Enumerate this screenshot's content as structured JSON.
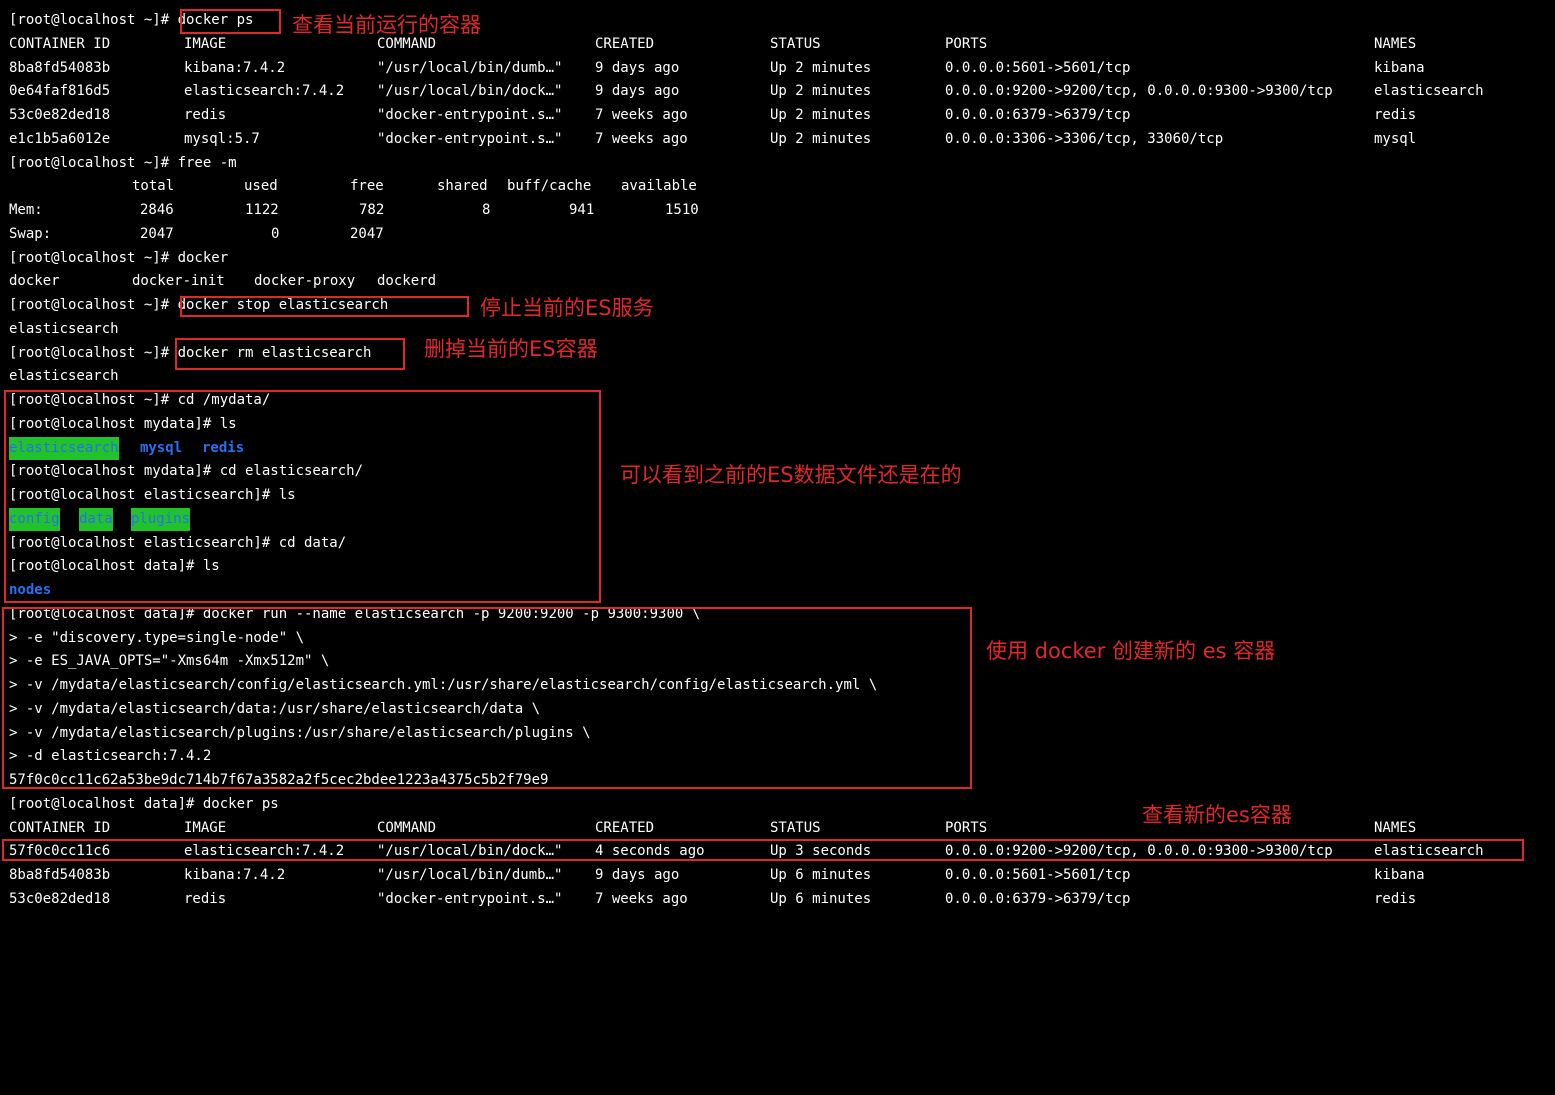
{
  "prompt": "[root@localhost ~]#",
  "terminal": {
    "cmd1": "[root@localhost ~]# docker ps",
    "ps1_headers": [
      "CONTAINER ID",
      "IMAGE",
      "COMMAND",
      "CREATED",
      "STATUS",
      "PORTS",
      "NAMES"
    ],
    "ps1_rows": [
      [
        "8ba8fd54083b",
        "kibana:7.4.2",
        "\"/usr/local/bin/dumb…\"",
        "9 days ago",
        "Up 2 minutes",
        "0.0.0.0:5601->5601/tcp",
        "kibana"
      ],
      [
        "0e64faf816d5",
        "elasticsearch:7.4.2",
        "\"/usr/local/bin/dock…\"",
        "9 days ago",
        "Up 2 minutes",
        "0.0.0.0:9200->9200/tcp, 0.0.0.0:9300->9300/tcp",
        "elasticsearch"
      ],
      [
        "53c0e82ded18",
        "redis",
        "\"docker-entrypoint.s…\"",
        "7 weeks ago",
        "Up 2 minutes",
        "0.0.0.0:6379->6379/tcp",
        "redis"
      ],
      [
        "e1c1b5a6012e",
        "mysql:5.7",
        "\"docker-entrypoint.s…\"",
        "7 weeks ago",
        "Up 2 minutes",
        "0.0.0.0:3306->3306/tcp, 33060/tcp",
        "mysql"
      ]
    ],
    "cmd2": "[root@localhost ~]# free -m",
    "free_headers": [
      "total",
      "used",
      "free",
      "shared",
      "buff/cache",
      "available"
    ],
    "free_mem": [
      "Mem:",
      "2846",
      "1122",
      "782",
      "8",
      "941",
      "1510"
    ],
    "free_swap": [
      "Swap:",
      "2047",
      "0",
      "2047"
    ],
    "cmd3": "[root@localhost ~]# docker",
    "docker_completions": [
      "docker",
      "docker-init",
      "docker-proxy",
      "dockerd"
    ],
    "cmd4": "[root@localhost ~]# docker stop elasticsearch",
    "out4": "elasticsearch",
    "cmd5": "[root@localhost ~]# docker rm elasticsearch",
    "out5": "elasticsearch",
    "cmd6": "[root@localhost ~]# cd /mydata/",
    "cmd7": "[root@localhost mydata]# ls",
    "ls1": [
      "elasticsearch",
      "mysql",
      "redis"
    ],
    "cmd8": "[root@localhost mydata]# cd elasticsearch/",
    "cmd9": "[root@localhost elasticsearch]# ls",
    "ls2": [
      "config",
      "data",
      "plugins"
    ],
    "cmd10": "[root@localhost elasticsearch]# cd data/",
    "cmd11": "[root@localhost data]# ls",
    "ls3": [
      "nodes"
    ],
    "run_lines": [
      "[root@localhost data]# docker run --name elasticsearch -p 9200:9200 -p 9300:9300 \\",
      "> -e \"discovery.type=single-node\" \\",
      "> -e ES_JAVA_OPTS=\"-Xms64m -Xmx512m\" \\",
      "> -v /mydata/elasticsearch/config/elasticsearch.yml:/usr/share/elasticsearch/config/elasticsearch.yml \\",
      "> -v /mydata/elasticsearch/data:/usr/share/elasticsearch/data \\",
      "> -v /mydata/elasticsearch/plugins:/usr/share/elasticsearch/plugins \\",
      "> -d elasticsearch:7.4.2"
    ],
    "container_hash": "57f0c0cc11c62a53be9dc714b7f67a3582a2f5cec2bdee1223a4375c5b2f79e9",
    "cmd12": "[root@localhost data]# docker ps",
    "ps2_rows": [
      [
        "57f0c0cc11c6",
        "elasticsearch:7.4.2",
        "\"/usr/local/bin/dock…\"",
        "4 seconds ago",
        "Up 3 seconds",
        "0.0.0.0:9200->9200/tcp, 0.0.0.0:9300->9300/tcp",
        "elasticsearch"
      ],
      [
        "8ba8fd54083b",
        "kibana:7.4.2",
        "\"/usr/local/bin/dumb…\"",
        "9 days ago",
        "Up 6 minutes",
        "0.0.0.0:5601->5601/tcp",
        "kibana"
      ],
      [
        "53c0e82ded18",
        "redis",
        "\"docker-entrypoint.s…\"",
        "7 weeks ago",
        "Up 6 minutes",
        "0.0.0.0:6379->6379/tcp",
        "redis"
      ]
    ]
  },
  "annotations": {
    "note1": "查看当前运行的容器",
    "note2": "停止当前的ES服务",
    "note3": "删掉当前的ES容器",
    "note4": "可以看到之前的ES数据文件还是在的",
    "note5": "使用 docker 创建新的 es 容器",
    "note6": "查看新的es容器"
  },
  "colors": {
    "background": "#000000",
    "text": "#ffffff",
    "annotation": "#e0282a",
    "dir_blue": "#2a6ff2",
    "dir_highlight": "#22c22a"
  }
}
